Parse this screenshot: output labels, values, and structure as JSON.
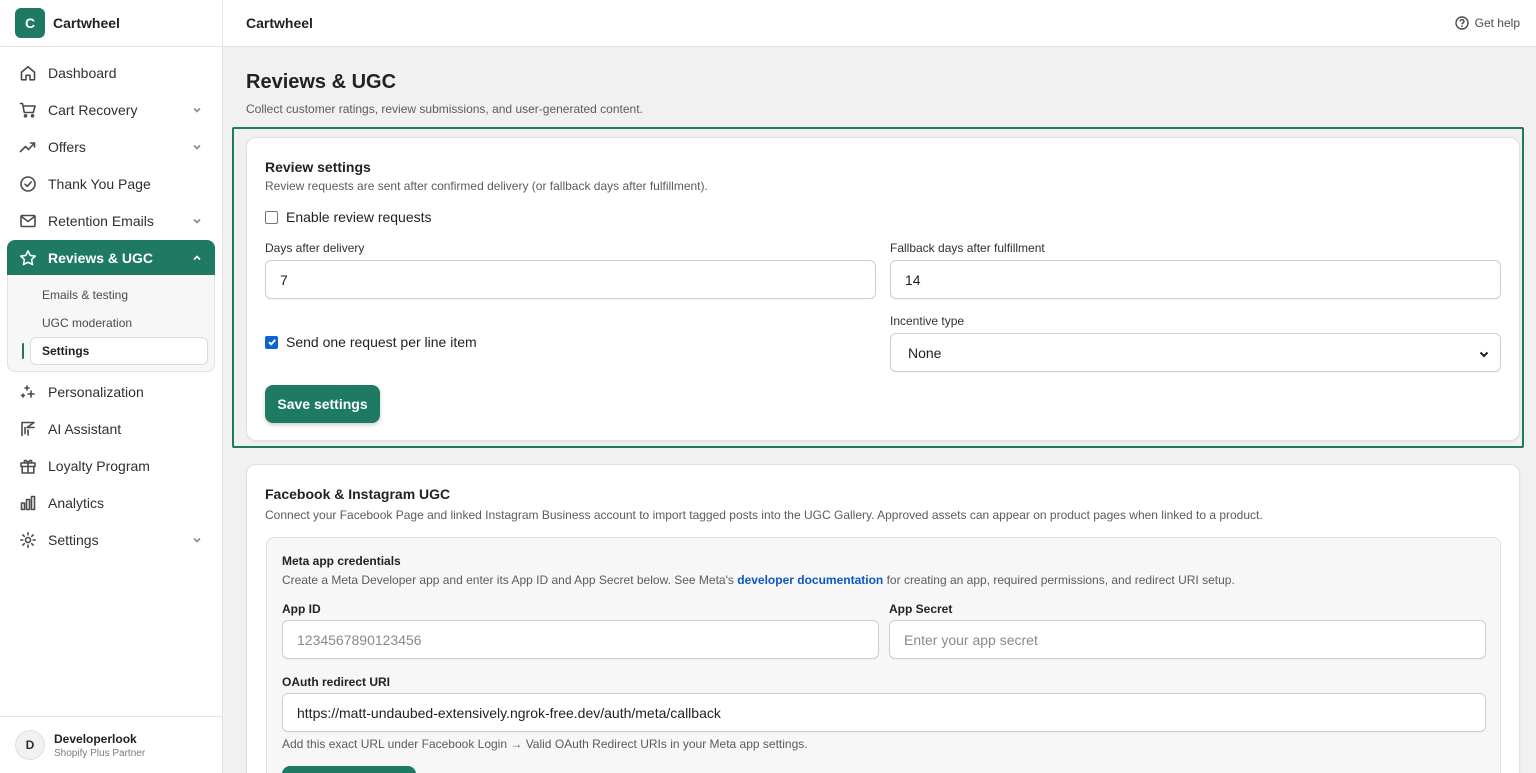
{
  "brand": {
    "logo_letter": "C",
    "name": "Cartwheel"
  },
  "sidebar": {
    "items": [
      {
        "label": "Dashboard",
        "icon": "home-icon"
      },
      {
        "label": "Cart Recovery",
        "icon": "cart-icon",
        "expandable": true
      },
      {
        "label": "Offers",
        "icon": "trend-icon",
        "expandable": true
      },
      {
        "label": "Thank You Page",
        "icon": "check-circle-icon"
      },
      {
        "label": "Retention Emails",
        "icon": "mail-icon",
        "expandable": true
      },
      {
        "label": "Reviews & UGC",
        "icon": "star-icon",
        "expandable": true,
        "active": true
      },
      {
        "label": "Personalization",
        "icon": "sparkle-icon"
      },
      {
        "label": "AI Assistant",
        "icon": "ai-icon"
      },
      {
        "label": "Loyalty Program",
        "icon": "gift-icon"
      },
      {
        "label": "Analytics",
        "icon": "bar-chart-icon"
      },
      {
        "label": "Settings",
        "icon": "gear-icon",
        "expandable": true
      }
    ],
    "subitems": [
      {
        "label": "Emails & testing"
      },
      {
        "label": "UGC moderation"
      },
      {
        "label": "Settings",
        "active": true
      }
    ]
  },
  "user": {
    "initial": "D",
    "name": "Developerlook",
    "role": "Shopify Plus Partner"
  },
  "topbar": {
    "title": "Cartwheel",
    "help_label": "Get help"
  },
  "page": {
    "title": "Reviews & UGC",
    "subtitle": "Collect customer ratings, review submissions, and user-generated content."
  },
  "review_settings": {
    "title": "Review settings",
    "subtitle": "Review requests are sent after confirmed delivery (or fallback days after fulfillment).",
    "enable_label": "Enable review requests",
    "enable_checked": false,
    "days_label": "Days after delivery",
    "days_value": "7",
    "fallback_label": "Fallback days after fulfillment",
    "fallback_value": "14",
    "per_line_label": "Send one request per line item",
    "per_line_checked": true,
    "incentive_label": "Incentive type",
    "incentive_value": "None",
    "save_label": "Save settings"
  },
  "ugc": {
    "title": "Facebook & Instagram UGC",
    "subtitle": "Connect your Facebook Page and linked Instagram Business account to import tagged posts into the UGC Gallery. Approved assets can appear on product pages when linked to a product.",
    "meta": {
      "title": "Meta app credentials",
      "desc_before": "Create a Meta Developer app and enter its App ID and App Secret below. See Meta's ",
      "desc_link": "developer documentation",
      "desc_after": " for creating an app, required permissions, and redirect URI setup.",
      "app_id_label": "App ID",
      "app_id_placeholder": "1234567890123456",
      "app_secret_label": "App Secret",
      "app_secret_placeholder": "Enter your app secret",
      "redirect_label": "OAuth redirect URI",
      "redirect_value": "https://matt-undaubed-extensively.ngrok-free.dev/auth/meta/callback",
      "redirect_hint": "Add this exact URL under Facebook Login → Valid OAuth Redirect URIs in your Meta app settings."
    }
  },
  "colors": {
    "accent": "#1f7a63",
    "link": "#0b57c2",
    "checkbox": "#0b63d6"
  }
}
